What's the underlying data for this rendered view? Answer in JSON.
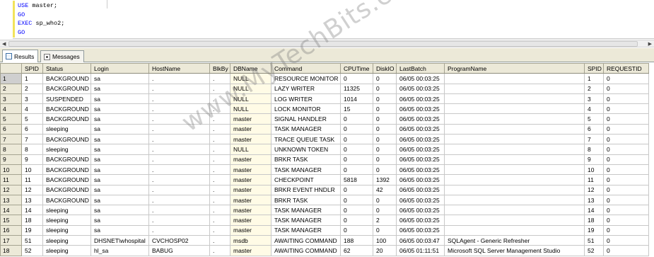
{
  "editor": {
    "lines": [
      {
        "kw": "USE",
        "rest": " master;"
      },
      {
        "kw": "GO",
        "rest": ""
      },
      {
        "kw": "EXEC",
        "rest": " sp_who2;"
      },
      {
        "kw": "GO",
        "rest": ""
      }
    ]
  },
  "tabs": [
    {
      "label": "Results",
      "icon": "grid-icon",
      "active": true
    },
    {
      "label": "Messages",
      "icon": "messages-icon",
      "active": false
    }
  ],
  "grid": {
    "columns": [
      "",
      "SPID",
      "Status",
      "Login",
      "HostName",
      "BlkBy",
      "DBName",
      "Command",
      "CPUTime",
      "DiskIO",
      "LastBatch",
      "ProgramName",
      "SPID",
      "REQUESTID"
    ],
    "rows": [
      [
        "1",
        "1",
        "BACKGROUND",
        "sa",
        ".",
        ".",
        "NULL",
        "RESOURCE MONITOR",
        "0",
        "0",
        "06/05 00:03:25",
        "",
        "1",
        "0"
      ],
      [
        "2",
        "2",
        "BACKGROUND",
        "sa",
        ".",
        ".",
        "NULL",
        "LAZY WRITER",
        "11325",
        "0",
        "06/05 00:03:25",
        "",
        "2",
        "0"
      ],
      [
        "3",
        "3",
        "SUSPENDED",
        "sa",
        ".",
        ".",
        "NULL",
        "LOG WRITER",
        "1014",
        "0",
        "06/05 00:03:25",
        "",
        "3",
        "0"
      ],
      [
        "4",
        "4",
        "BACKGROUND",
        "sa",
        ".",
        ".",
        "NULL",
        "LOCK MONITOR",
        "15",
        "0",
        "06/05 00:03:25",
        "",
        "4",
        "0"
      ],
      [
        "5",
        "5",
        "BACKGROUND",
        "sa",
        ".",
        ".",
        "master",
        "SIGNAL HANDLER",
        "0",
        "0",
        "06/05 00:03:25",
        "",
        "5",
        "0"
      ],
      [
        "6",
        "6",
        "sleeping",
        "sa",
        ".",
        ".",
        "master",
        "TASK MANAGER",
        "0",
        "0",
        "06/05 00:03:25",
        "",
        "6",
        "0"
      ],
      [
        "7",
        "7",
        "BACKGROUND",
        "sa",
        ".",
        ".",
        "master",
        "TRACE QUEUE TASK",
        "0",
        "0",
        "06/05 00:03:25",
        "",
        "7",
        "0"
      ],
      [
        "8",
        "8",
        "sleeping",
        "sa",
        ".",
        ".",
        "NULL",
        "UNKNOWN TOKEN",
        "0",
        "0",
        "06/05 00:03:25",
        "",
        "8",
        "0"
      ],
      [
        "9",
        "9",
        "BACKGROUND",
        "sa",
        ".",
        ".",
        "master",
        "BRKR TASK",
        "0",
        "0",
        "06/05 00:03:25",
        "",
        "9",
        "0"
      ],
      [
        "10",
        "10",
        "BACKGROUND",
        "sa",
        ".",
        ".",
        "master",
        "TASK MANAGER",
        "0",
        "0",
        "06/05 00:03:25",
        "",
        "10",
        "0"
      ],
      [
        "11",
        "11",
        "BACKGROUND",
        "sa",
        ".",
        ".",
        "master",
        "CHECKPOINT",
        "5818",
        "1392",
        "06/05 00:03:25",
        "",
        "11",
        "0"
      ],
      [
        "12",
        "12",
        "BACKGROUND",
        "sa",
        ".",
        ".",
        "master",
        "BRKR EVENT HNDLR",
        "0",
        "42",
        "06/05 00:03:25",
        "",
        "12",
        "0"
      ],
      [
        "13",
        "13",
        "BACKGROUND",
        "sa",
        ".",
        ".",
        "master",
        "BRKR TASK",
        "0",
        "0",
        "06/05 00:03:25",
        "",
        "13",
        "0"
      ],
      [
        "14",
        "14",
        "sleeping",
        "sa",
        ".",
        ".",
        "master",
        "TASK MANAGER",
        "0",
        "0",
        "06/05 00:03:25",
        "",
        "14",
        "0"
      ],
      [
        "15",
        "18",
        "sleeping",
        "sa",
        ".",
        ".",
        "master",
        "TASK MANAGER",
        "0",
        "2",
        "06/05 00:03:25",
        "",
        "18",
        "0"
      ],
      [
        "16",
        "19",
        "sleeping",
        "sa",
        ".",
        ".",
        "master",
        "TASK MANAGER",
        "0",
        "0",
        "06/05 00:03:25",
        "",
        "19",
        "0"
      ],
      [
        "17",
        "51",
        "sleeping",
        "DHSNET\\whospital",
        "CVCHOSP02",
        ".",
        "msdb",
        "AWAITING COMMAND",
        "188",
        "100",
        "06/05 00:03:47",
        "SQLAgent - Generic Refresher",
        "51",
        "0"
      ],
      [
        "18",
        "52",
        "sleeping",
        "hl_sa",
        "BABUG",
        ".",
        "master",
        "AWAITING COMMAND",
        "62",
        "20",
        "06/05 01:11:51",
        "Microsoft SQL Server Management Studio",
        "52",
        "0"
      ]
    ]
  },
  "watermark": "www.MyTechBits.com"
}
